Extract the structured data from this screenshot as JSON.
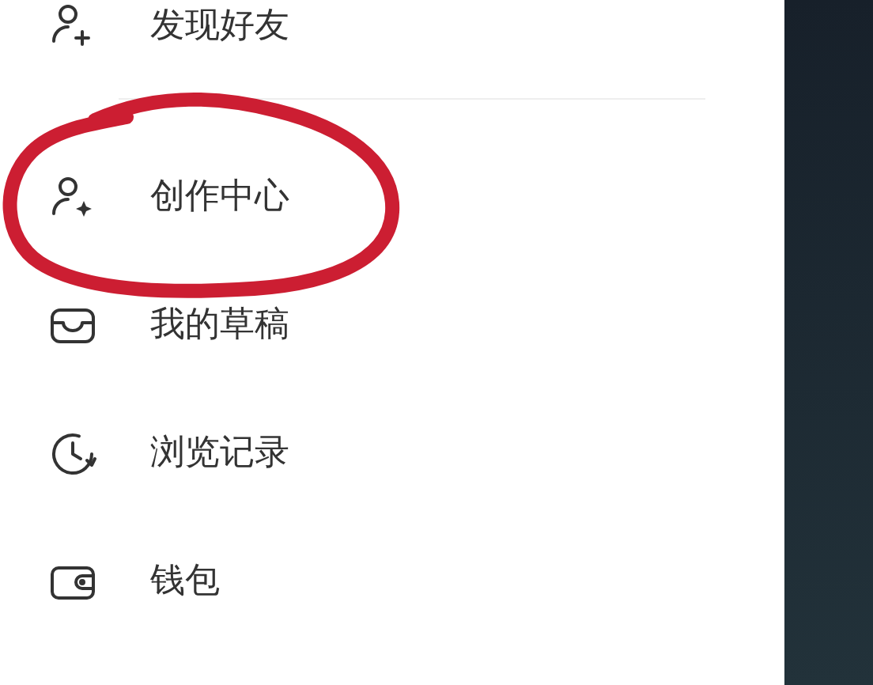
{
  "menu": {
    "items": [
      {
        "label": "发现好友",
        "highlighted": false
      },
      {
        "label": "创作中心",
        "highlighted": true
      },
      {
        "label": "我的草稿",
        "highlighted": false
      },
      {
        "label": "浏览记录",
        "highlighted": false
      },
      {
        "label": "钱包",
        "highlighted": false
      }
    ]
  }
}
